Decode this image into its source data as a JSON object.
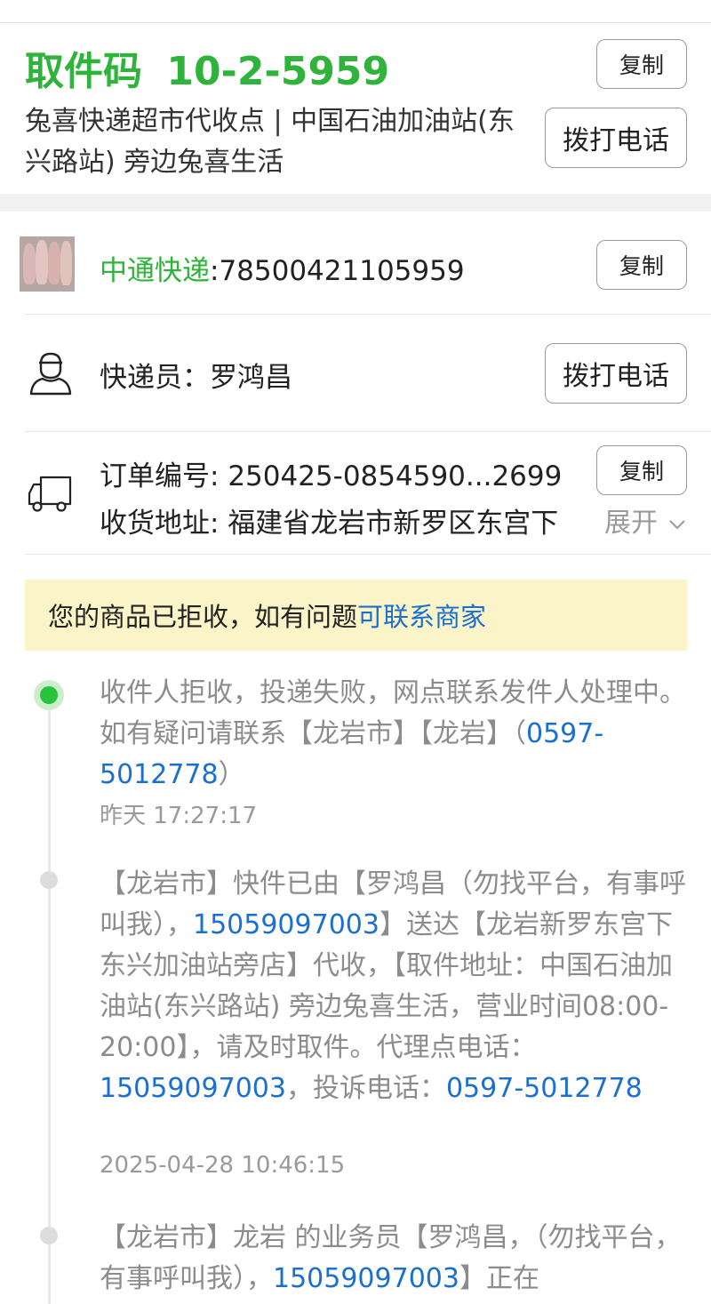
{
  "pickup": {
    "label": "取件码",
    "code": "10-2-5959",
    "station": "兔喜快递超市代收点 | 中国石油加油站(东兴路站) 旁边兔喜生活",
    "copy_label": "复制",
    "call_label": "拨打电话"
  },
  "parcel": {
    "carrier": "中通快递",
    "tracking_number": ":78500421105959",
    "copy_label": "复制"
  },
  "courier": {
    "label": "快递员：",
    "name": "罗鸿昌",
    "call_label": "拨打电话"
  },
  "order": {
    "number_label": "订单编号: ",
    "number": "250425-0854590...2699",
    "copy_label": "复制",
    "address_label": "收货地址: ",
    "address": "福建省龙岩市新罗区东宫下",
    "expand_label": "展开",
    "expand_icon": "chevron-down-icon"
  },
  "notice": {
    "text": "您的商品已拒收，如有问题",
    "link": "可联系商家",
    "bg_color": "#fbf4c9"
  },
  "events": [
    {
      "p1": "收件人拒收，投递失败，网点联系发件人处理中。如有疑问请联系【龙岩市】【龙岩】（",
      "phone1": "0597-5012778",
      "p2": "）",
      "time": "昨天 17:27:17"
    },
    {
      "p1": "【龙岩市】快件已由【罗鸿昌（勿找平台，有事呼叫我），",
      "phone1": "15059097003",
      "p2": "】送达【龙岩新罗东宫下东兴加油站旁店】代收，【取件地址：中国石油加油站(东兴路站) 旁边兔喜生活，营业时间08:00-20:00】，请及时取件。代理点电话：",
      "phone2": "15059097003",
      "p3": "，投诉电话：",
      "phone3": "0597-5012778",
      "time": "2025-04-28 10:46:15"
    },
    {
      "p1": "【龙岩市】龙岩 的业务员【罗鸿昌，（勿找平台，有事呼叫我），",
      "phone1": "15059097003",
      "p2": "】正在"
    }
  ],
  "colors": {
    "accent_green": "#2fb33b",
    "link_blue": "#1a6fd1",
    "active_dot": "#27c33a"
  }
}
